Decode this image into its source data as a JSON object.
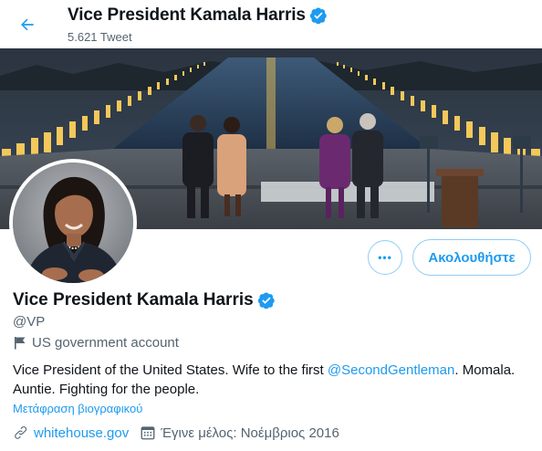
{
  "header": {
    "title": "Vice President Kamala Harris",
    "tweet_count": "5.621 Tweet"
  },
  "profile": {
    "name": "Vice President Kamala Harris",
    "handle": "@VP",
    "account_label": "US government account",
    "bio_prefix": "Vice President of the United States. Wife to the first ",
    "bio_mention": "@SecondGentleman",
    "bio_suffix": ". Momala. Auntie. Fighting for the people.",
    "translate_label": "Μετάφραση βιογραφικού",
    "website": "whitehouse.gov",
    "joined": "Έγινε μέλος: Νοέμβριος 2016"
  },
  "actions": {
    "more_label": "•••",
    "follow_label": "Ακολουθήστε"
  },
  "colors": {
    "accent": "#1d9bf0",
    "text": "#0f1419",
    "secondary": "#536471"
  }
}
